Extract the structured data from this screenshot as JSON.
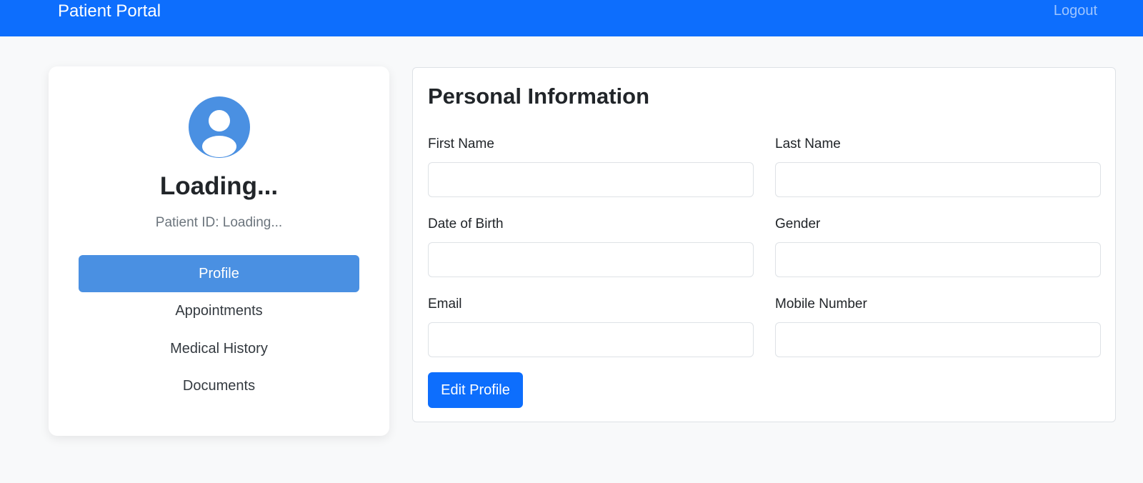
{
  "navbar": {
    "brand": "Patient Portal",
    "logout_label": "Logout"
  },
  "sidebar": {
    "avatar_icon": "user-circle-icon",
    "name": "Loading...",
    "patient_id": "Patient ID: Loading...",
    "items": [
      {
        "label": "Profile",
        "active": true
      },
      {
        "label": "Appointments",
        "active": false
      },
      {
        "label": "Medical History",
        "active": false
      },
      {
        "label": "Documents",
        "active": false
      }
    ]
  },
  "main": {
    "title": "Personal Information",
    "fields": {
      "first_name": {
        "label": "First Name",
        "value": ""
      },
      "last_name": {
        "label": "Last Name",
        "value": ""
      },
      "dob": {
        "label": "Date of Birth",
        "value": ""
      },
      "gender": {
        "label": "Gender",
        "value": ""
      },
      "email": {
        "label": "Email",
        "value": ""
      },
      "mobile": {
        "label": "Mobile Number",
        "value": ""
      }
    },
    "edit_label": "Edit Profile"
  },
  "colors": {
    "navbar": "#0d6efd",
    "accent": "#4a90e2",
    "button": "#0d6efd",
    "background": "#f8f9fa"
  }
}
